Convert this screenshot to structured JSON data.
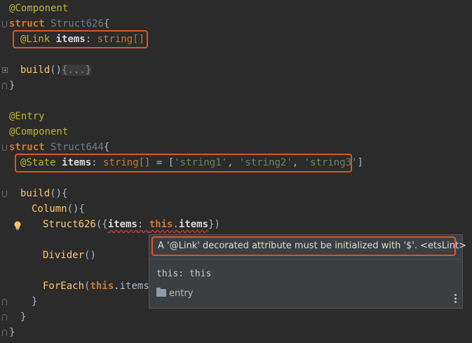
{
  "code": {
    "l1_ann": "@Component",
    "l2_kw": "struct",
    "l2_name": "Struct626",
    "l2_brace": "{",
    "l3_ann": "@Link",
    "l3_prop": "items",
    "l3_colon": ":",
    "l3_type": "string[]",
    "l5_fn": "build",
    "l5_parens": "()",
    "l5_fold": "{...}",
    "l6_brace": "}",
    "l8_ann": "@Entry",
    "l9_ann": "@Component",
    "l10_kw": "struct",
    "l10_name": "Struct644",
    "l10_brace": "{",
    "l11_ann": "@State",
    "l11_prop": "items",
    "l11_colon": ":",
    "l11_type": "string[]",
    "l11_eq": " = [",
    "l11_s1": "'string1'",
    "l11_comma1": ", ",
    "l11_s2": "'string2'",
    "l11_comma2": ", ",
    "l11_s3": "'string3'",
    "l11_close": "]",
    "l13_fn": "build",
    "l13_rest": "(){",
    "l14_call": "Column",
    "l14_rest": "(){",
    "l15_call": "Struct626",
    "l15_open": "({",
    "l15_key": "items",
    "l15_colon": ": ",
    "l15_this": "this",
    "l15_dot": ".",
    "l15_prop": "items",
    "l15_close": "})",
    "l17_call": "Divider",
    "l17_rest": "()",
    "l19_call": "ForEach",
    "l19_open": "(",
    "l19_this": "this",
    "l19_rest": ".items,",
    "l20_brace": "}",
    "l21_brace": "}",
    "l22_brace": "}"
  },
  "popup": {
    "message": "A '@Link' decorated attribute must be initialized with '$'. <etsLint>",
    "signature": "this: this",
    "module": "entry"
  },
  "colors": {
    "highlight": "#e0522a",
    "background": "#2b2b2b"
  }
}
